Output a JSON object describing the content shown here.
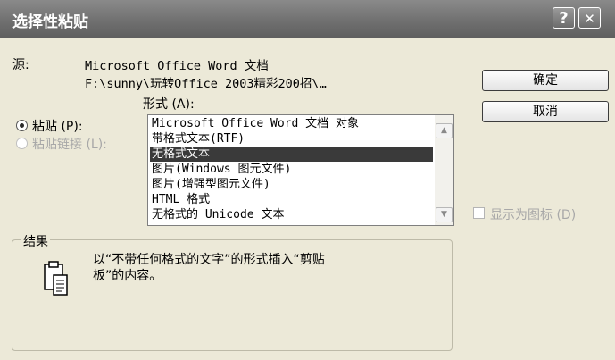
{
  "window": {
    "title": "选择性粘贴",
    "help_label": "?",
    "close_label": "✕"
  },
  "source": {
    "label": "源:",
    "line1": "Microsoft Office Word 文档",
    "line2": "F:\\sunny\\玩转Office 2003精彩200招\\…"
  },
  "format": {
    "label": "形式 (A):"
  },
  "options": {
    "paste_label": "粘贴 (P):",
    "paste_link_label": "粘贴链接 (L):"
  },
  "list": {
    "items": [
      "Microsoft Office Word 文档 对象",
      "带格式文本(RTF)",
      "无格式文本",
      "图片(Windows 图元文件)",
      "图片(增强型图元文件)",
      "HTML 格式",
      "无格式的 Unicode 文本"
    ],
    "selected_index": 2
  },
  "buttons": {
    "ok": "确定",
    "cancel": "取消"
  },
  "display_as_icon": {
    "label": "显示为图标 (D)",
    "checked": false
  },
  "result": {
    "label": "结果",
    "text_line1": "以“不带任何格式的文字”的形式插入“剪贴",
    "text_line2": "板”的内容。"
  },
  "icons": {
    "result_icon": "clipboard-paste-icon"
  }
}
